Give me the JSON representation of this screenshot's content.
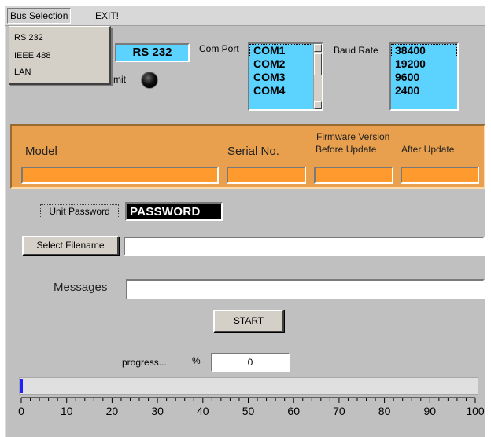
{
  "menubar": {
    "bus_selection": "Bus Selection",
    "exit": "EXIT!"
  },
  "bus_menu": {
    "items": [
      "RS 232",
      "IEEE 488",
      "LAN"
    ]
  },
  "bus": {
    "current": "RS 232",
    "transmit_label_partial": "smit"
  },
  "com_port": {
    "label": "Com Port",
    "options": [
      "COM1",
      "COM2",
      "COM3",
      "COM4"
    ],
    "selected": "COM1"
  },
  "baud_rate": {
    "label": "Baud Rate",
    "options": [
      "38400",
      "19200",
      "9600",
      "2400"
    ],
    "selected": "38400"
  },
  "firmware": {
    "model_label": "Model",
    "serial_label": "Serial No.",
    "version_label": "Firmware Version",
    "before_label": "Before Update",
    "after_label": "After Update",
    "model_value": "",
    "serial_value": "",
    "before_value": "",
    "after_value": ""
  },
  "password": {
    "label": "Unit Password",
    "value": "PASSWORD"
  },
  "filename": {
    "button": "Select Filename",
    "value": ""
  },
  "messages": {
    "label": "Messages",
    "value": ""
  },
  "start": {
    "label": "START"
  },
  "progress": {
    "label": "progress...",
    "percent_symbol": "%",
    "percent_value": "0",
    "fraction": 0,
    "scale_labels": [
      "0",
      "10",
      "20",
      "30",
      "40",
      "50",
      "60",
      "70",
      "80",
      "90",
      "100"
    ]
  },
  "colors": {
    "accent_cyan": "#5cd2ff",
    "orange_panel": "#e8a04e",
    "orange_field": "#ff9a2e",
    "progress_blue": "#2020ff"
  }
}
